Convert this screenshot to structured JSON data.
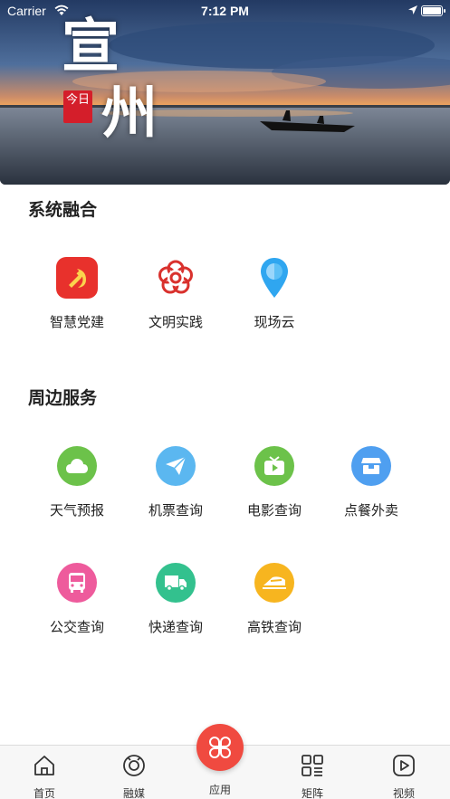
{
  "status_bar": {
    "carrier": "Carrier",
    "time": "7:12 PM"
  },
  "banner": {
    "title_line1": "宣",
    "title_line2": "州",
    "seal_text": "今日"
  },
  "sections": [
    {
      "title": "系统融合",
      "items": [
        {
          "label": "智慧党建",
          "icon": "party-emblem-icon"
        },
        {
          "label": "文明实践",
          "icon": "flower-icon"
        },
        {
          "label": "现场云",
          "icon": "location-pin-icon"
        }
      ]
    },
    {
      "title": "周边服务",
      "items": [
        {
          "label": "天气预报",
          "icon": "cloud-icon",
          "color": "#6cc24a"
        },
        {
          "label": "机票查询",
          "icon": "paper-plane-icon",
          "color": "#5bb7f0"
        },
        {
          "label": "电影查询",
          "icon": "tv-play-icon",
          "color": "#6cc24a"
        },
        {
          "label": "点餐外卖",
          "icon": "food-box-icon",
          "color": "#4f9ff0"
        },
        {
          "label": "公交查询",
          "icon": "bus-icon",
          "color": "#ee5b9c"
        },
        {
          "label": "快递查询",
          "icon": "truck-icon",
          "color": "#33c18e"
        },
        {
          "label": "高铁查询",
          "icon": "train-icon",
          "color": "#f7b51f"
        }
      ]
    }
  ],
  "tab_bar": {
    "items": [
      {
        "label": "首页",
        "icon": "home-icon"
      },
      {
        "label": "融媒",
        "icon": "media-icon"
      },
      {
        "label": "应用",
        "icon": "apps-icon",
        "active": true
      },
      {
        "label": "矩阵",
        "icon": "matrix-icon"
      },
      {
        "label": "视频",
        "icon": "video-play-icon"
      }
    ]
  },
  "colors": {
    "accent_red": "#f04a40",
    "party_red": "#e8312c"
  }
}
